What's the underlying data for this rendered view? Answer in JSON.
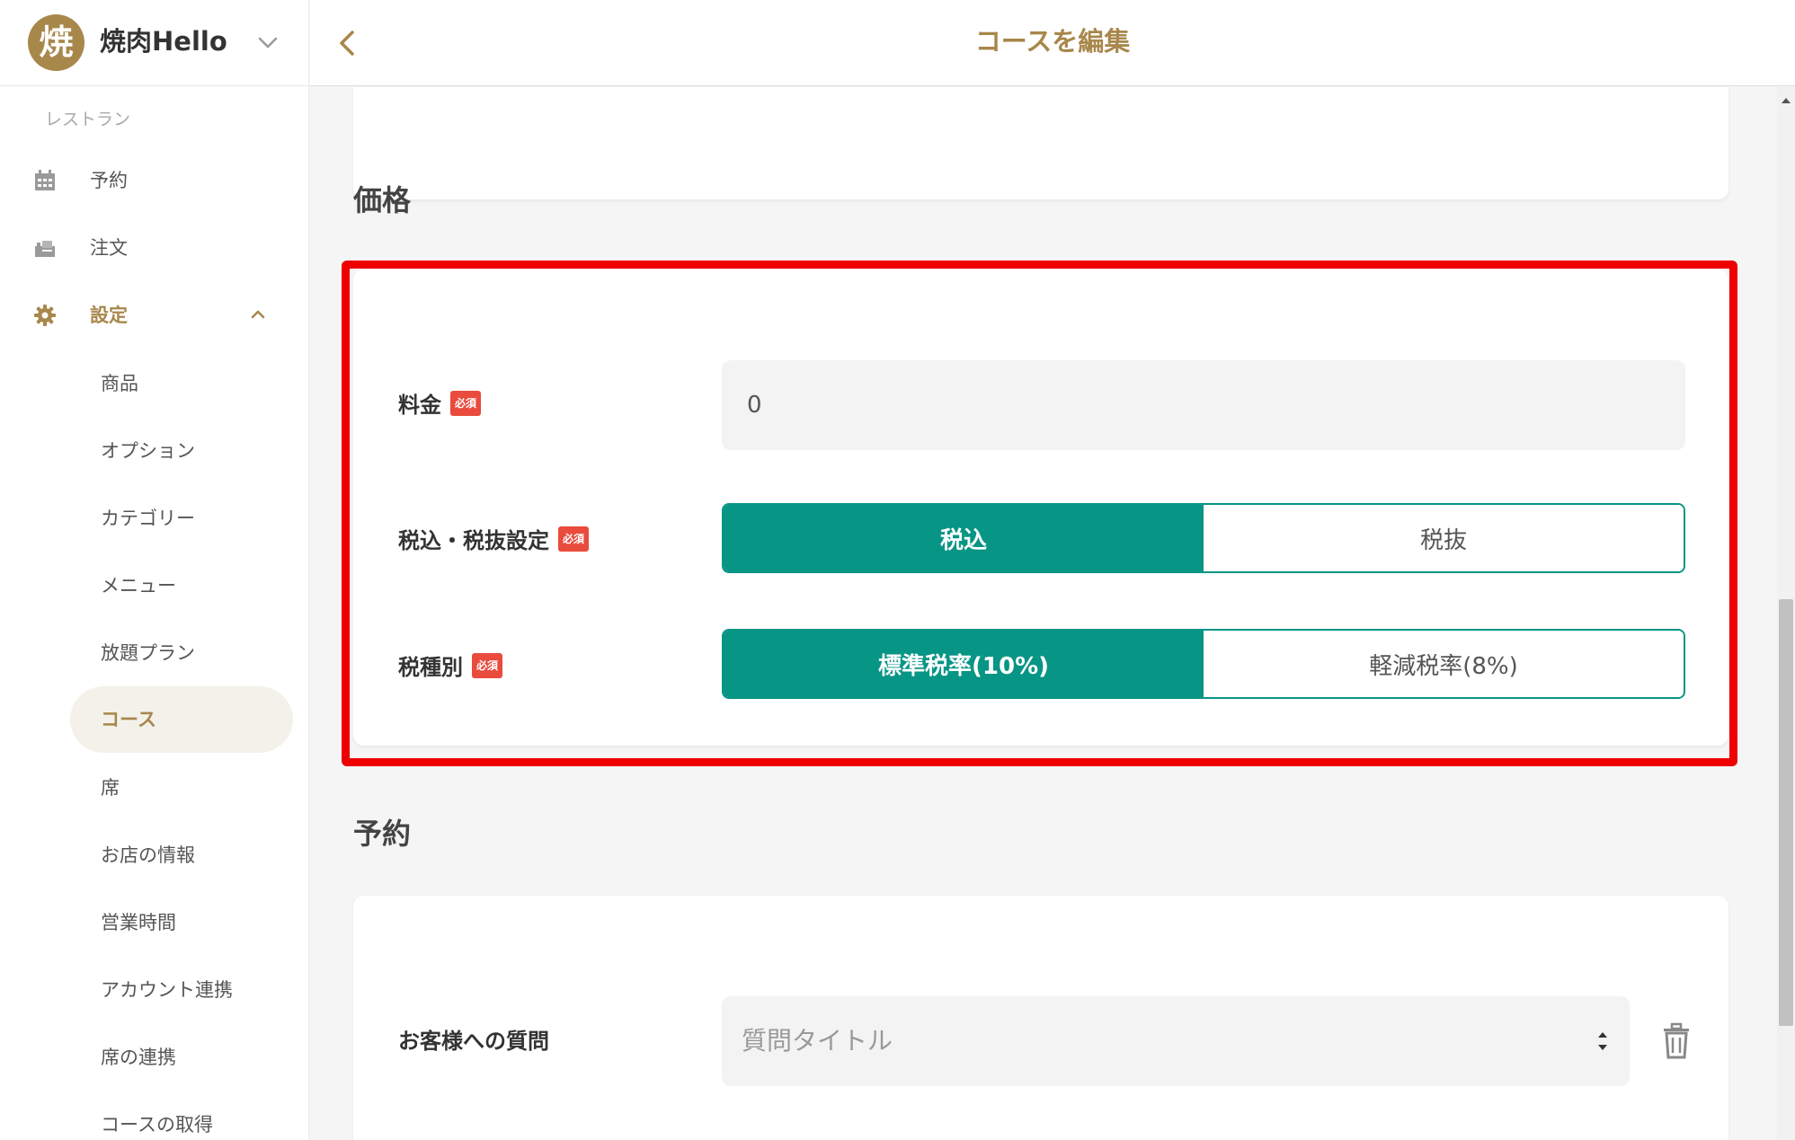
{
  "brand": {
    "logo_char": "焼",
    "name": "焼肉Hello"
  },
  "sidebar": {
    "section_label": "レストラン",
    "items": [
      {
        "label": "予約",
        "icon": "calendar-icon"
      },
      {
        "label": "注文",
        "icon": "order-icon"
      },
      {
        "label": "設定",
        "icon": "gear-icon",
        "expanded": true
      }
    ],
    "settings_subitems": [
      {
        "label": "商品"
      },
      {
        "label": "オプション"
      },
      {
        "label": "カテゴリー"
      },
      {
        "label": "メニュー"
      },
      {
        "label": "放題プラン"
      },
      {
        "label": "コース",
        "active": true
      },
      {
        "label": "席"
      },
      {
        "label": "お店の情報"
      },
      {
        "label": "営業時間"
      },
      {
        "label": "アカウント連携"
      },
      {
        "label": "席の連携"
      },
      {
        "label": "コースの取得"
      }
    ]
  },
  "header": {
    "title": "コースを編集"
  },
  "price_section": {
    "heading": "価格",
    "required_badge": "必須",
    "fee": {
      "label": "料金",
      "value": "0"
    },
    "tax_setting": {
      "label": "税込・税抜設定",
      "options": [
        "税込",
        "税抜"
      ],
      "selected": "税込"
    },
    "tax_type": {
      "label": "税種別",
      "options": [
        "標準税率(10%)",
        "軽減税率(8%)"
      ],
      "selected": "標準税率(10%)"
    }
  },
  "reservation_section": {
    "heading": "予約",
    "question": {
      "label": "お客様への質問",
      "placeholder": "質問タイトル"
    }
  },
  "colors": {
    "accent_gold": "#a8874b",
    "teal": "#079585",
    "required_red": "#e94b3c",
    "highlight_red": "#ee0000",
    "active_bg": "#f3f1ea"
  }
}
